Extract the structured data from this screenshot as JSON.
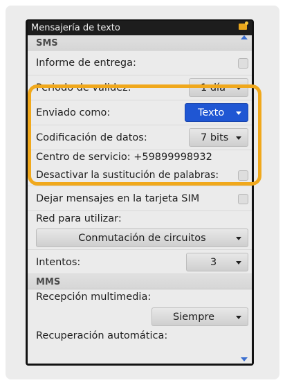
{
  "titlebar": {
    "title": "Mensajería de texto"
  },
  "sms": {
    "header": "SMS",
    "delivery_report": {
      "label": "Informe de entrega:"
    },
    "validity": {
      "label": "Periodo de validez:",
      "value": "1 día"
    },
    "sent_as": {
      "label": "Enviado como:",
      "value": "Texto"
    },
    "encoding": {
      "label": "Codificación de datos:",
      "value": "7 bits"
    },
    "service_center": {
      "text": "Centro de servicio: +59899998932"
    },
    "word_sub": {
      "label": "Desactivar la sustitución de palabras:"
    },
    "keep_on_sim": {
      "label": "Dejar mensajes en la tarjeta SIM"
    },
    "network": {
      "label": "Red para utilizar:",
      "value": "Conmutación de circuitos"
    },
    "retries": {
      "label": "Intentos:",
      "value": "3"
    }
  },
  "mms": {
    "header": "MMS",
    "reception": {
      "label": "Recepción multimedia:",
      "value": "Siempre"
    },
    "auto_retrieval": {
      "label": "Recuperación automática:"
    }
  },
  "colors": {
    "highlight": "#f0a81c",
    "selected_dropdown": "#1f56d3"
  },
  "icons": {
    "titlebar": "mail-notification-icon"
  }
}
